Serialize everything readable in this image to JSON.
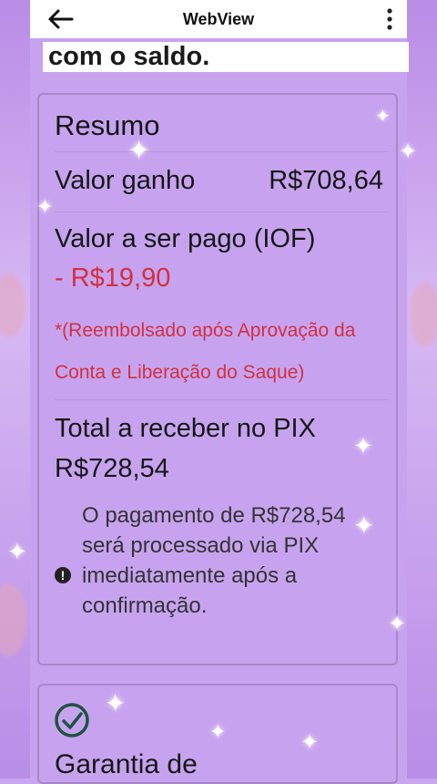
{
  "header": {
    "title": "WebView"
  },
  "intro_text": "com o saldo.",
  "summary": {
    "heading": "Resumo",
    "earned_label": "Valor ganho",
    "earned_value": "R$708,64",
    "fee_label": "Valor a ser pago (IOF)",
    "fee_value": "- R$19,90",
    "refund_note_line1": "*(Reembolsado após Aprovação da",
    "refund_note_line2": "Conta e Liberação do Saque)",
    "total_label": "Total a receber no PIX",
    "total_value": "R$728,54",
    "info_note": "O pagamento de R$728,54 será processado via PIX imediatamente após a confirmação."
  },
  "guarantee": {
    "title": "Garantia de"
  },
  "colors": {
    "panel": "#c7a3ef",
    "fee_red": "#d2303e",
    "card_border": "#a987c9"
  },
  "icons": {
    "back": "arrow-left-icon",
    "more": "more-vertical-icon",
    "info": "info-icon",
    "check": "check-circle-icon"
  }
}
